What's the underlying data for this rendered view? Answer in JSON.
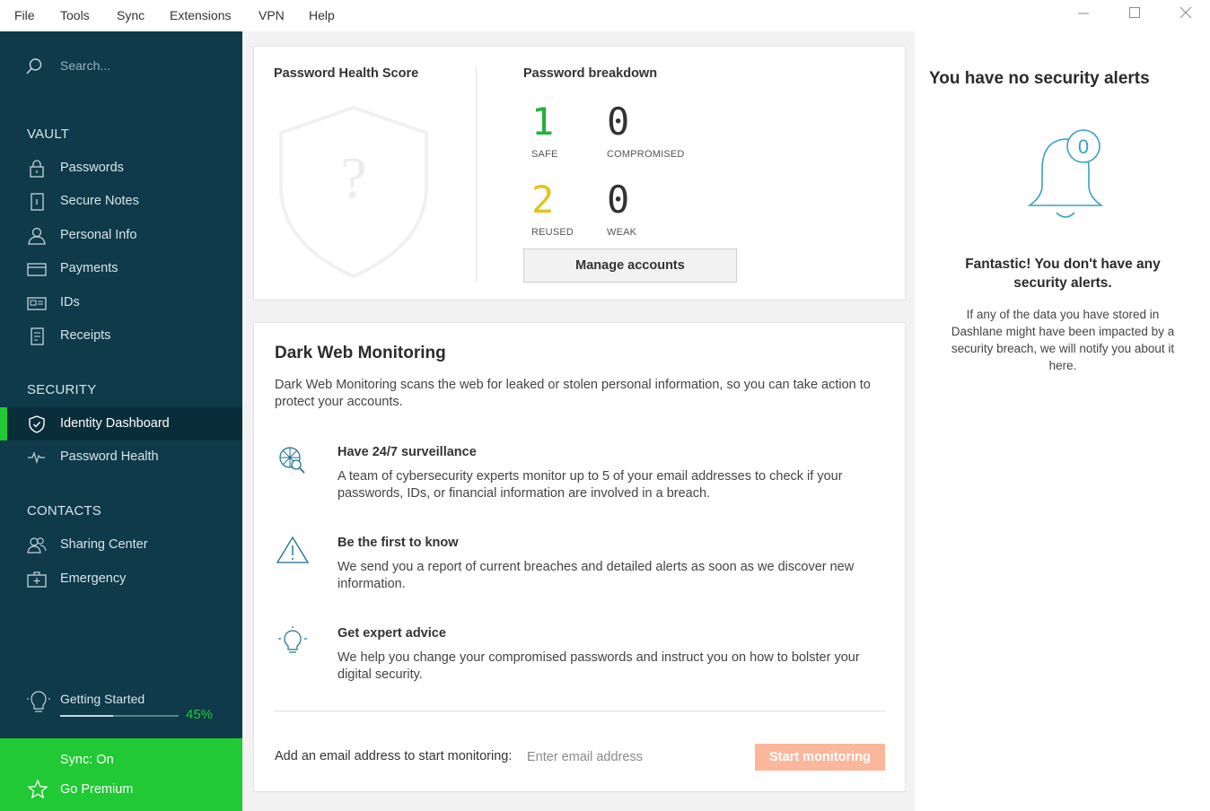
{
  "menubar": {
    "items": [
      "File",
      "Tools",
      "Sync",
      "Extensions",
      "VPN",
      "Help"
    ],
    "window_controls": {
      "minimize": "—",
      "maximize": "☐",
      "close": "✕"
    }
  },
  "sidebar": {
    "search_placeholder": "Search...",
    "sections": {
      "vault": "VAULT",
      "security": "SECURITY",
      "contacts": "CONTACTS"
    },
    "items": [
      {
        "label": "Passwords",
        "icon": "lock-icon"
      },
      {
        "label": "Secure Notes",
        "icon": "note-icon"
      },
      {
        "label": "Personal Info",
        "icon": "person-icon"
      },
      {
        "label": "Payments",
        "icon": "card-icon"
      },
      {
        "label": "IDs",
        "icon": "id-card-icon"
      },
      {
        "label": "Receipts",
        "icon": "receipt-icon"
      },
      {
        "label": "Identity Dashboard",
        "icon": "shield-icon",
        "active": true
      },
      {
        "label": "Password Health",
        "icon": "pulse-icon"
      },
      {
        "label": "Sharing Center",
        "icon": "people-icon"
      },
      {
        "label": "Emergency",
        "icon": "emergency-kit-icon"
      }
    ],
    "getting_started": {
      "label": "Getting Started",
      "percent_text": "45%",
      "progress": 0.45
    },
    "sync_label": "Sync: On",
    "premium_label": "Go Premium",
    "colors": {
      "background": "#0e3a4a",
      "accent": "#21c934"
    }
  },
  "health": {
    "score_title": "Password Health Score",
    "score_placeholder": "?",
    "breakdown_title": "Password breakdown",
    "stats": {
      "safe": {
        "value": "1",
        "label": "SAFE",
        "color": "#21b13a"
      },
      "compromised": {
        "value": "0",
        "label": "COMPROMISED",
        "color": "#333333"
      },
      "reused": {
        "value": "2",
        "label": "REUSED",
        "color": "#e4c21e"
      },
      "weak": {
        "value": "0",
        "label": "WEAK",
        "color": "#333333"
      }
    },
    "manage_button": "Manage accounts"
  },
  "dwm": {
    "title": "Dark Web Monitoring",
    "description": "Dark Web Monitoring scans the web for leaked or stolen personal information, so you can take action to protect your accounts.",
    "features": [
      {
        "icon": "web-search-icon",
        "title": "Have 24/7 surveillance",
        "text": "A team of cybersecurity experts monitor up to 5 of your email addresses to check if your passwords, IDs, or financial information are involved in a breach."
      },
      {
        "icon": "warning-icon",
        "title": "Be the first to know",
        "text": "We send you a report of current breaches and detailed alerts as soon as we discover new information."
      },
      {
        "icon": "lightbulb-icon",
        "title": "Get expert advice",
        "text": "We help you change your compromised passwords and instruct you on how to bolster your digital security."
      }
    ],
    "add_email_label": "Add an email address to start monitoring:",
    "email_placeholder": "Enter email address",
    "start_button": "Start monitoring"
  },
  "alerts": {
    "title": "You have no security alerts",
    "bell_badge": "0",
    "headline": "Fantastic! You don't have any security alerts.",
    "body": "If any of the data you have stored in Dashlane might have been impacted by a security breach, we will notify you about it here."
  }
}
